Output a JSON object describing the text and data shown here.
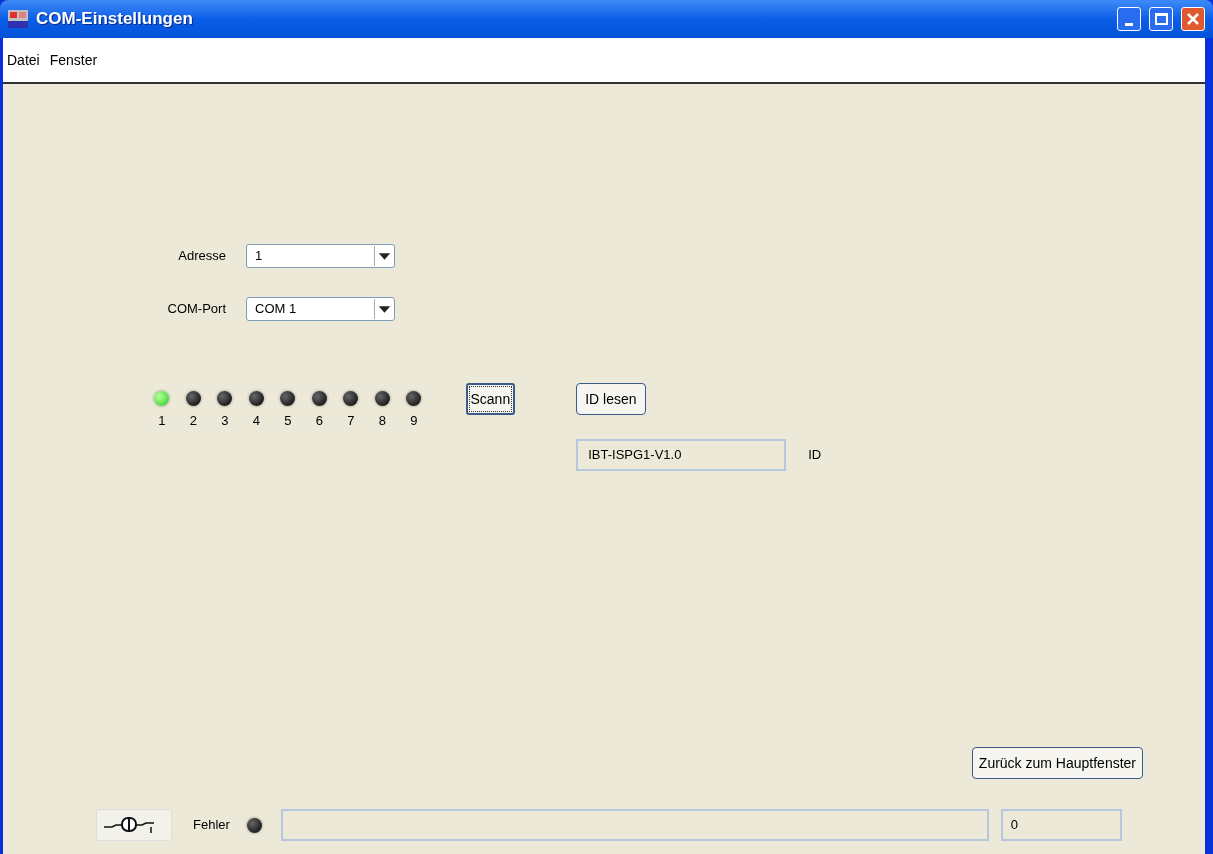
{
  "window": {
    "title": "COM-Einstellungen"
  },
  "menu": [
    "Datei",
    "Fenster"
  ],
  "fields": [
    {
      "label": "Adresse",
      "value": "1"
    },
    {
      "label": "COM-Port",
      "value": "COM 1"
    }
  ],
  "leds": [
    {
      "label": "1",
      "on": true
    },
    {
      "label": "2",
      "on": false
    },
    {
      "label": "3",
      "on": false
    },
    {
      "label": "4",
      "on": false
    },
    {
      "label": "5",
      "on": false
    },
    {
      "label": "6",
      "on": false
    },
    {
      "label": "7",
      "on": false
    },
    {
      "label": "8",
      "on": false
    },
    {
      "label": "9",
      "on": false
    }
  ],
  "scan_button": "Scann",
  "id_button": "ID lesen",
  "id_field": {
    "value": "IBT-ISPG1-V1.0",
    "label": "ID"
  },
  "back_button": "Zurück zum Hauptfenster",
  "status": {
    "error_label": "Fehler",
    "error_on": false,
    "count": "0"
  }
}
